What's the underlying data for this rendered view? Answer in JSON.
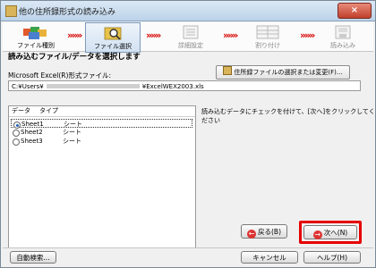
{
  "window": {
    "title": "他の住所録形式の読み込み",
    "close_label": "×"
  },
  "steps": [
    {
      "label": "ファイル種別",
      "state": "done",
      "icon": "folders-icon"
    },
    {
      "label": "ファイル選択",
      "state": "active",
      "icon": "folder-search-icon"
    },
    {
      "label": "詳細設定",
      "state": "dim",
      "icon": "detail-settings-icon"
    },
    {
      "label": "割り付け",
      "state": "dim",
      "icon": "mapping-icon"
    },
    {
      "label": "読み込み",
      "state": "dim",
      "icon": "load-icon"
    }
  ],
  "arrows": "»»»",
  "section_title": "読み込むファイル/データを選択します",
  "file_label": "Microsoft Excel(R)形式ファイル:",
  "select_file_button": "住所録ファイルの選択または変更(F)...",
  "file_path_prefix": "C:¥Users¥",
  "file_path_suffix": "¥ExcelWEX2003.xls",
  "sheet_table": {
    "headers": [
      "データ",
      "タイプ"
    ],
    "rows": [
      {
        "name": "Sheet1",
        "type": "シート",
        "selected": true
      },
      {
        "name": "Sheet2",
        "type": "シート",
        "selected": false
      },
      {
        "name": "Sheet3",
        "type": "シート",
        "selected": false
      }
    ]
  },
  "instruction": "読み込むデータにチェックを付けて、[次へ]をクリックしてください",
  "buttons": {
    "back": "戻る(B)",
    "next": "次へ(N)",
    "auto_search": "自動検索...",
    "cancel": "キャンセル",
    "help": "ヘルプ(H)"
  },
  "colors": {
    "highlight": "#e60000",
    "arrow": "#d60000",
    "active_step": "#d2e1f1"
  }
}
